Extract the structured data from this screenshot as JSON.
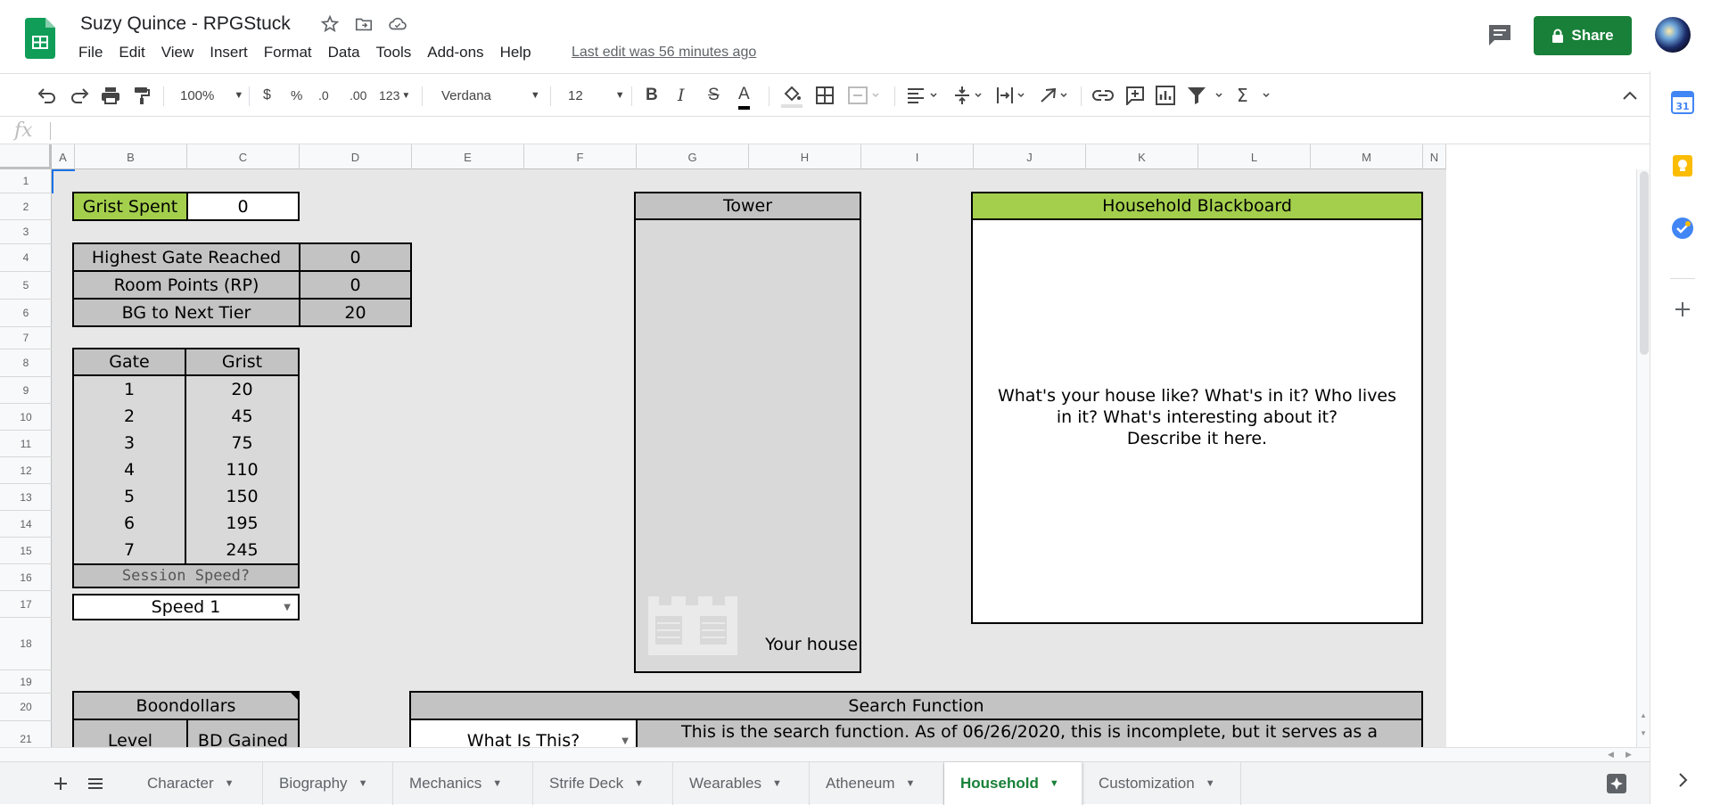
{
  "app": {
    "title": "Suzy Quince - RPGStuck",
    "last_edit": "Last edit was 56 minutes ago",
    "share_label": "Share",
    "brand_color": "#0f9d58",
    "share_color": "#188038"
  },
  "menu": [
    "File",
    "Edit",
    "View",
    "Insert",
    "Format",
    "Data",
    "Tools",
    "Add-ons",
    "Help"
  ],
  "toolbar": {
    "zoom": "100%",
    "currency": "$",
    "percent": "%",
    "dec_decrease": ".0",
    "dec_increase": ".00",
    "number_format": "123",
    "font": "Verdana",
    "font_size": "12",
    "bold": "B",
    "italic": "I",
    "strike": "S",
    "text_color": "A",
    "sum": "Σ"
  },
  "formula_bar": {
    "fx": "fx",
    "value": ""
  },
  "columns": [
    "A",
    "B",
    "C",
    "D",
    "E",
    "F",
    "G",
    "H",
    "I",
    "J",
    "K",
    "L",
    "M",
    "N"
  ],
  "rows": [
    "1",
    "2",
    "3",
    "4",
    "5",
    "6",
    "7",
    "8",
    "9",
    "10",
    "11",
    "12",
    "13",
    "14",
    "15",
    "16",
    "17",
    "18",
    "19",
    "20",
    "21"
  ],
  "cells": {
    "grist_spent_label": "Grist Spent",
    "grist_spent_value": "0",
    "highest_gate_label": "Highest Gate Reached",
    "highest_gate_value": "0",
    "room_points_label": "Room Points (RP)",
    "room_points_value": "0",
    "bg_next_tier_label": "BG to Next Tier",
    "bg_next_tier_value": "20",
    "gate_header": "Gate",
    "grist_header": "Grist",
    "gates": [
      {
        "gate": "1",
        "grist": "20"
      },
      {
        "gate": "2",
        "grist": "45"
      },
      {
        "gate": "3",
        "grist": "75"
      },
      {
        "gate": "4",
        "grist": "110"
      },
      {
        "gate": "5",
        "grist": "150"
      },
      {
        "gate": "6",
        "grist": "195"
      },
      {
        "gate": "7",
        "grist": "245"
      }
    ],
    "session_speed_label": "Session Speed?",
    "session_speed_value": "Speed 1",
    "tower_header": "Tower",
    "tower_house_label": "Your house",
    "blackboard_header": "Household Blackboard",
    "blackboard_text_1": "What's your house like? What's in it? Who lives",
    "blackboard_text_2": "in it? What's interesting about it?",
    "blackboard_text_3": "Describe it here.",
    "boondollars_header": "Boondollars",
    "level_header": "Level",
    "bd_gained_header": "BD Gained",
    "search_header": "Search Function",
    "search_dropdown": "What Is This?",
    "search_text": "This is the search function. As of 06/26/2020, this is incomplete, but it serves as a"
  },
  "sheets": [
    {
      "name": "Character",
      "active": false
    },
    {
      "name": "Biography",
      "active": false
    },
    {
      "name": "Mechanics",
      "active": false
    },
    {
      "name": "Strife Deck",
      "active": false
    },
    {
      "name": "Wearables",
      "active": false
    },
    {
      "name": "Atheneum",
      "active": false
    },
    {
      "name": "Household",
      "active": true
    },
    {
      "name": "Customization",
      "active": false
    }
  ],
  "colors": {
    "cell_green": "#a4cf4d",
    "cell_gray": "#c3c3c3",
    "sheet_bg": "#e7e7e7",
    "active_tab": "#188038"
  }
}
